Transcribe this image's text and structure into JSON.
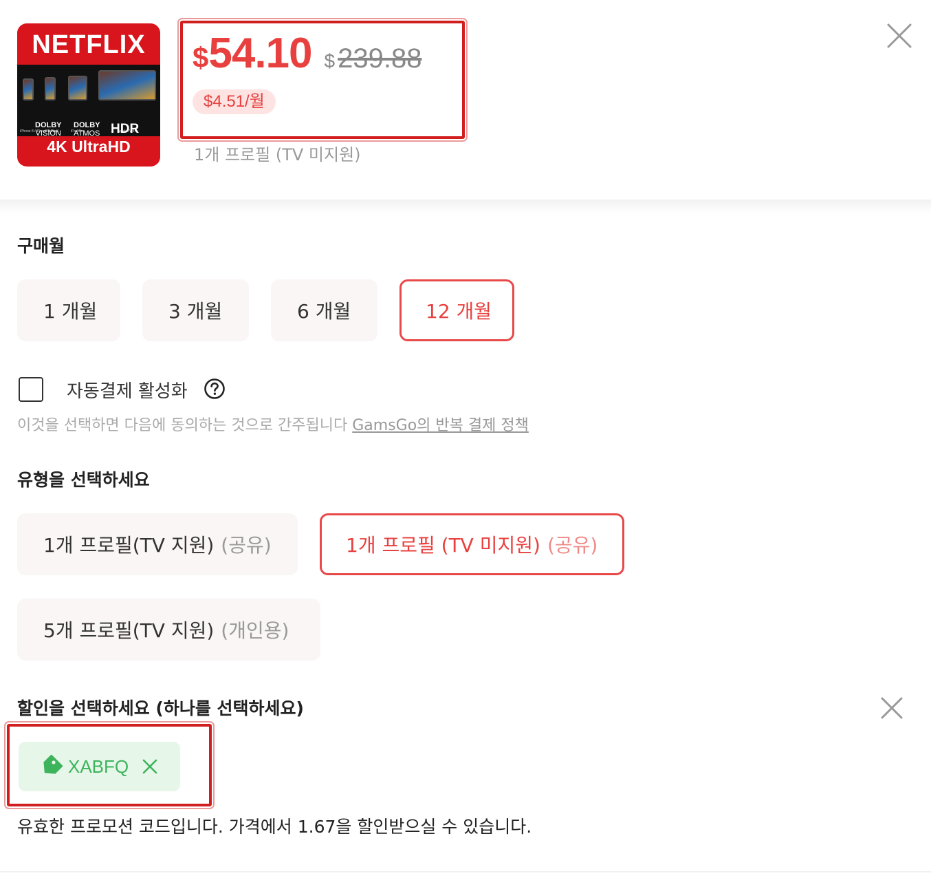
{
  "product": {
    "thumbnail": {
      "brand": "NETFLIX",
      "device_captions": [
        "iPhone 8 / iPhone 8 Plus",
        "iPhone X",
        "iPad Pro",
        "Apple TV 4K"
      ],
      "features": {
        "dolby_vision_top": "DOLBY",
        "dolby_vision_bottom": "VISION",
        "dolby_atmos_top": "DOLBY",
        "dolby_atmos_bottom": "ATMOS",
        "hdr": "HDR",
        "uhd": "4K UltraHD"
      }
    },
    "price": {
      "currency": "$",
      "current": "54.10",
      "original_currency": "$",
      "original": "239.88"
    },
    "monthly": "$4.51/월",
    "selected_type": "1개 프로필 (TV 미지원)"
  },
  "months": {
    "title": "구매월",
    "options": [
      {
        "label": "1 개월",
        "selected": false
      },
      {
        "label": "3 개월",
        "selected": false
      },
      {
        "label": "6 개월",
        "selected": false
      },
      {
        "label": "12 개월",
        "selected": true
      }
    ]
  },
  "autopay": {
    "label": "자동결제 활성화",
    "checked": false,
    "terms_text": "이것을 선택하면 다음에 동의하는 것으로 간주됩니다 ",
    "terms_link": "GamsGo의 반복 결제 정책"
  },
  "type": {
    "title": "유형을 선택하세요",
    "options": [
      {
        "label": "1개 프로필(TV 지원)",
        "sub": "(공유)",
        "selected": false
      },
      {
        "label": "1개 프로필 (TV 미지원)",
        "sub": "(공유)",
        "selected": true
      },
      {
        "label": "5개 프로필(TV 지원)",
        "sub": "(개인용)",
        "selected": false
      }
    ]
  },
  "discount": {
    "title": "할인을 선택하세요 (하나를 선택하세요)",
    "coupon_code": "XABFQ",
    "message": "유효한 프로모션 코드입니다. 가격에서 1.67을 할인받으실 수 있습니다."
  },
  "colors": {
    "accent": "#e8403e",
    "coupon_green": "#3db45c",
    "netflix_red": "#d8141c"
  },
  "icons": [
    "close-icon",
    "help-icon",
    "tag-icon",
    "remove-icon"
  ]
}
